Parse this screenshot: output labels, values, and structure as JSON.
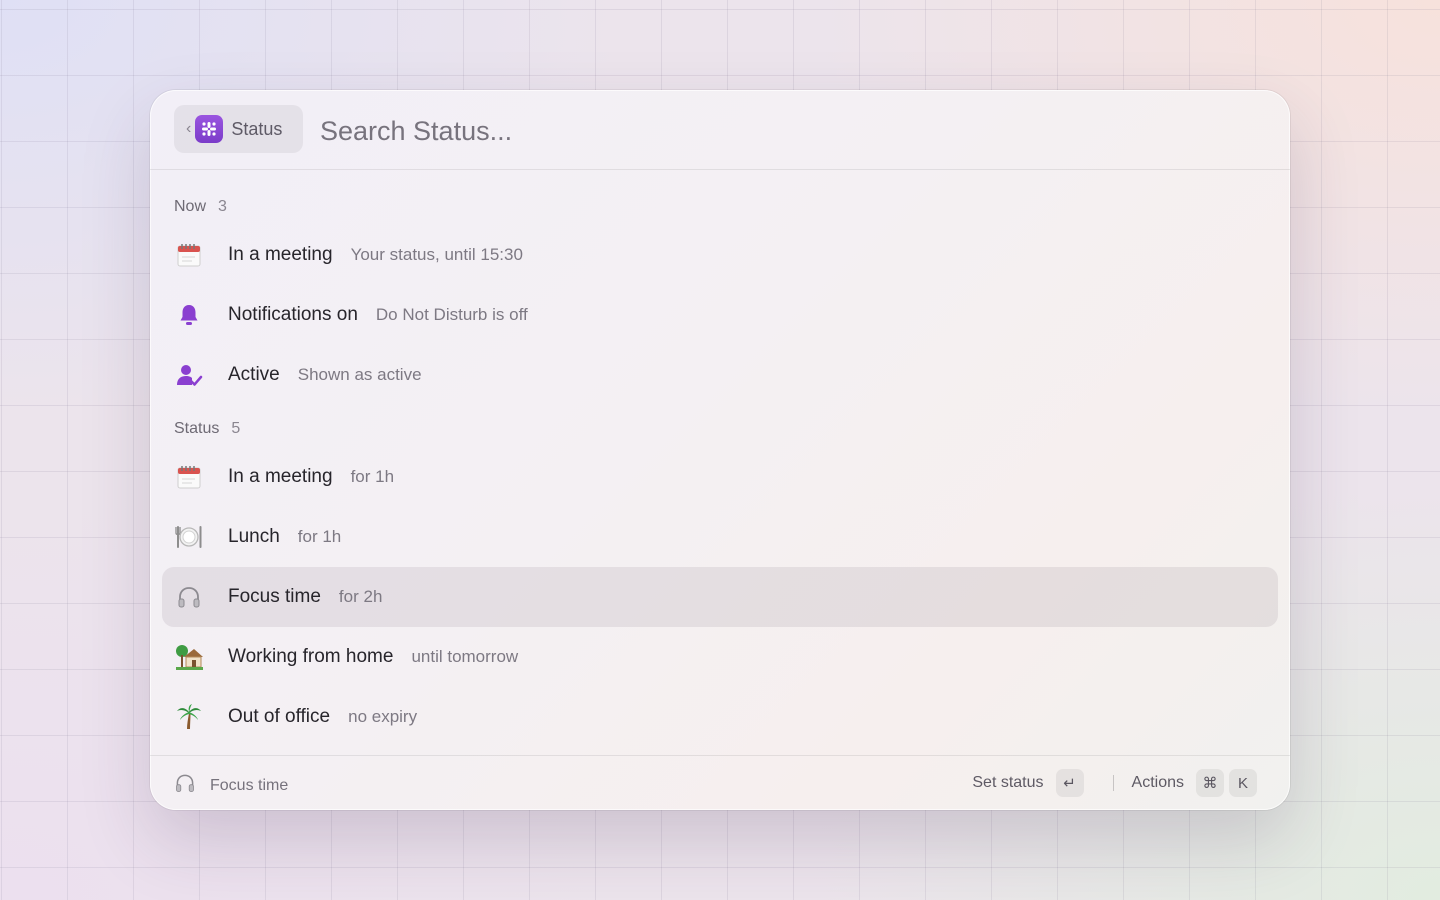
{
  "header": {
    "back_label": "Status",
    "search_placeholder": "Search Status..."
  },
  "sections": [
    {
      "title": "Now",
      "count": "3",
      "items": [
        {
          "title": "In a meeting",
          "subtitle": "Your status, until 15:30",
          "icon": "calendar-icon"
        },
        {
          "title": "Notifications on",
          "subtitle": "Do Not Disturb is off",
          "icon": "bell-icon"
        },
        {
          "title": "Active",
          "subtitle": "Shown as active",
          "icon": "user-check-icon"
        }
      ]
    },
    {
      "title": "Status",
      "count": "5",
      "items": [
        {
          "title": "In a meeting",
          "subtitle": "for 1h",
          "icon": "calendar-icon"
        },
        {
          "title": "Lunch",
          "subtitle": "for 1h",
          "icon": "plate-cutlery-icon"
        },
        {
          "title": "Focus time",
          "subtitle": "for 2h",
          "icon": "headphones-icon",
          "selected": true
        },
        {
          "title": "Working from home",
          "subtitle": "until tomorrow",
          "icon": "house-tree-icon"
        },
        {
          "title": "Out of office",
          "subtitle": "no expiry",
          "icon": "palm-tree-icon"
        }
      ]
    }
  ],
  "footer": {
    "selected_label": "Focus time",
    "primary_action": "Set status",
    "primary_key": "↵",
    "actions_label": "Actions",
    "actions_keys": [
      "⌘",
      "K"
    ]
  },
  "colors": {
    "accent": "#7b3cc9",
    "selection": "#e5e0e2"
  }
}
